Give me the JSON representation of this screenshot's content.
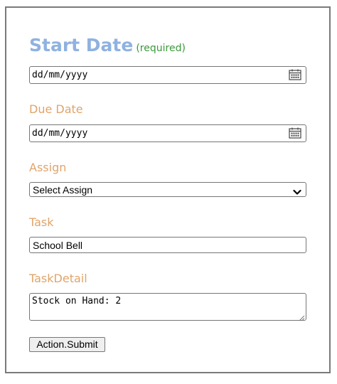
{
  "form": {
    "start_date": {
      "label": "Start Date",
      "required_note": "(required)",
      "value": "dd/mm/yyyy",
      "icon": "calendar-icon"
    },
    "due_date": {
      "label": "Due Date",
      "value": "dd/mm/yyyy",
      "icon": "calendar-icon"
    },
    "assign": {
      "label": "Assign",
      "selected": "Select Assign",
      "icon": "chevron-down-icon"
    },
    "task": {
      "label": "Task",
      "value": "School Bell"
    },
    "task_detail": {
      "label": "TaskDetail",
      "value": "Stock on Hand: 2",
      "icon": "resize-grip-icon"
    },
    "submit_label": "Action.Submit"
  },
  "colors": {
    "title": "#8fb2e0",
    "required": "#3a9a3a",
    "label": "#e0a46a",
    "border": "#767676"
  }
}
